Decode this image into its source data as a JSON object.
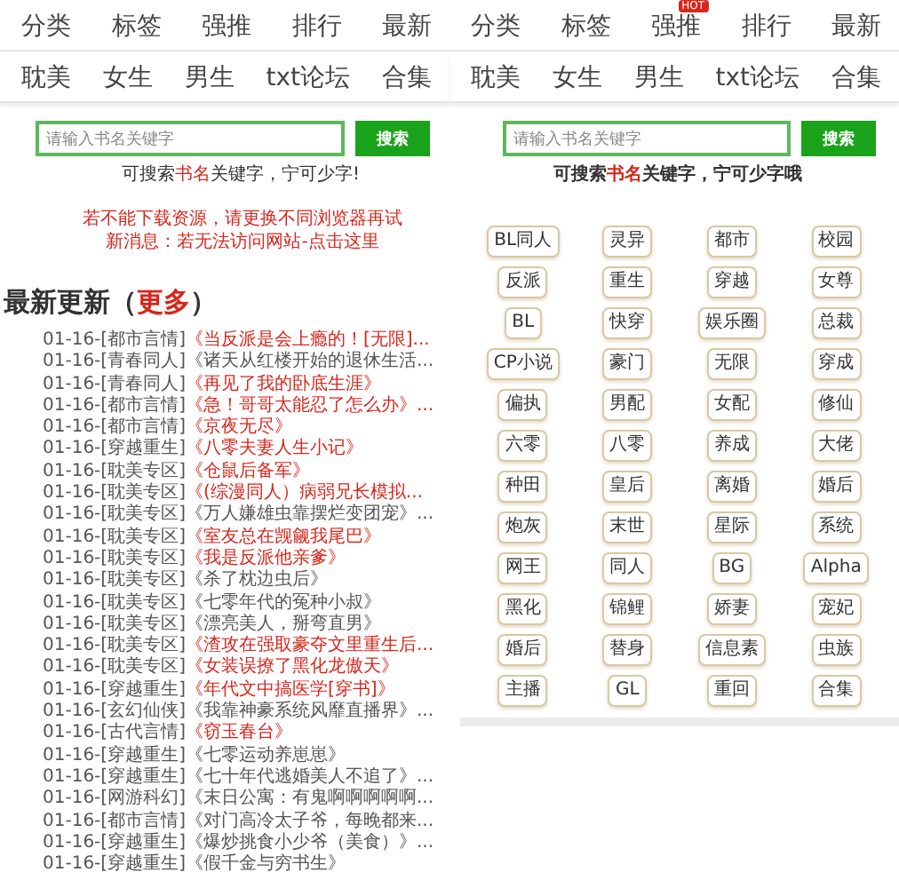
{
  "left_panel": {
    "nav_rows": [
      [
        {
          "label": "分类"
        },
        {
          "label": "标签"
        },
        {
          "label": "强推"
        },
        {
          "label": "排行"
        },
        {
          "label": "最新"
        }
      ],
      [
        {
          "label": "耽美"
        },
        {
          "label": "女生"
        },
        {
          "label": "男生"
        },
        {
          "label": "txt论坛"
        },
        {
          "label": "合集"
        }
      ]
    ],
    "search": {
      "placeholder": "请输入书名关键字",
      "button": "搜索"
    },
    "hint": {
      "before": "可搜索",
      "highlight": "书名",
      "after": "关键字，宁可少字!"
    },
    "notices": [
      "若不能下载资源，请更换不同浏览器再试",
      "新消息：若无法访问网站-点击这里"
    ],
    "latest": {
      "title": "最新更新（",
      "more": "更多",
      "close": "）"
    },
    "updates": [
      {
        "date": "01-16-",
        "category": "[都市言情]",
        "title": "《当反派是会上瘾的！[无限]...",
        "highlight": true
      },
      {
        "date": "01-16-",
        "category": "[青春同人]",
        "title": "《诸天从红楼开始的退休生活...",
        "highlight": false
      },
      {
        "date": "01-16-",
        "category": "[青春同人]",
        "title": "《再见了我的卧底生涯》",
        "highlight": true
      },
      {
        "date": "01-16-",
        "category": "[都市言情]",
        "title": "《急！哥哥太能忍了怎么办》...",
        "highlight": true
      },
      {
        "date": "01-16-",
        "category": "[都市言情]",
        "title": "《京夜无尽》",
        "highlight": true
      },
      {
        "date": "01-16-",
        "category": "[穿越重生]",
        "title": "《八零夫妻人生小记》",
        "highlight": true
      },
      {
        "date": "01-16-",
        "category": "[耽美专区]",
        "title": "《仓鼠后备军》",
        "highlight": true
      },
      {
        "date": "01-16-",
        "category": "[耽美专区]",
        "title": "《(综漫同人）病弱兄长模拟...",
        "highlight": true
      },
      {
        "date": "01-16-",
        "category": "[耽美专区]",
        "title": "《万人嫌雄虫靠摆烂变团宠》...",
        "highlight": false
      },
      {
        "date": "01-16-",
        "category": "[耽美专区]",
        "title": "《室友总在觊觎我尾巴》",
        "highlight": true
      },
      {
        "date": "01-16-",
        "category": "[耽美专区]",
        "title": "《我是反派他亲爹》",
        "highlight": true
      },
      {
        "date": "01-16-",
        "category": "[耽美专区]",
        "title": "《杀了枕边虫后》",
        "highlight": false
      },
      {
        "date": "01-16-",
        "category": "[耽美专区]",
        "title": "《七零年代的冤种小叔》",
        "highlight": false
      },
      {
        "date": "01-16-",
        "category": "[耽美专区]",
        "title": "《漂亮美人，掰弯直男》",
        "highlight": false
      },
      {
        "date": "01-16-",
        "category": "[耽美专区]",
        "title": "《渣攻在强取豪夺文里重生后...",
        "highlight": true
      },
      {
        "date": "01-16-",
        "category": "[耽美专区]",
        "title": "《女装误撩了黑化龙傲天》",
        "highlight": true
      },
      {
        "date": "01-16-",
        "category": "[穿越重生]",
        "title": "《年代文中搞医学[穿书]》",
        "highlight": true
      },
      {
        "date": "01-16-",
        "category": "[玄幻仙侠]",
        "title": "《我靠神豪系统风靡直播界》...",
        "highlight": false
      },
      {
        "date": "01-16-",
        "category": "[古代言情]",
        "title": "《窃玉春台》",
        "highlight": true
      },
      {
        "date": "01-16-",
        "category": "[穿越重生]",
        "title": "《七零运动养崽崽》",
        "highlight": false
      },
      {
        "date": "01-16-",
        "category": "[穿越重生]",
        "title": "《七十年代逃婚美人不追了》...",
        "highlight": false
      },
      {
        "date": "01-16-",
        "category": "[网游科幻]",
        "title": "《末日公寓：有鬼啊啊啊啊啊...",
        "highlight": false
      },
      {
        "date": "01-16-",
        "category": "[都市言情]",
        "title": "《对门高冷太子爷，每晚都来...",
        "highlight": false
      },
      {
        "date": "01-16-",
        "category": "[穿越重生]",
        "title": "《爆炒挑食小少爷（美食）》...",
        "highlight": false
      },
      {
        "date": "01-16-",
        "category": "[穿越重生]",
        "title": "《假千金与穷书生》",
        "highlight": false
      }
    ]
  },
  "right_panel": {
    "nav_rows": [
      [
        {
          "label": "分类"
        },
        {
          "label": "标签"
        },
        {
          "label": "强推",
          "badge": "HOT"
        },
        {
          "label": "排行"
        },
        {
          "label": "最新"
        }
      ],
      [
        {
          "label": "耽美"
        },
        {
          "label": "女生"
        },
        {
          "label": "男生"
        },
        {
          "label": "txt论坛"
        },
        {
          "label": "合集"
        }
      ]
    ],
    "search": {
      "placeholder": "请输入书名关键字",
      "button": "搜索"
    },
    "hint": {
      "before": "可搜索",
      "highlight": "书名",
      "after": "关键字，宁可少字哦"
    },
    "tags": [
      "BL同人",
      "灵异",
      "都市",
      "校园",
      "反派",
      "重生",
      "穿越",
      "女尊",
      "BL",
      "快穿",
      "娱乐圈",
      "总裁",
      "CP小说",
      "豪门",
      "无限",
      "穿成",
      "偏执",
      "男配",
      "女配",
      "修仙",
      "六零",
      "八零",
      "养成",
      "大佬",
      "种田",
      "皇后",
      "离婚",
      "婚后",
      "炮灰",
      "末世",
      "星际",
      "系统",
      "网王",
      "同人",
      "BG",
      "Alpha",
      "黑化",
      "锦鲤",
      "娇妻",
      "宠妃",
      "婚后",
      "替身",
      "信息素",
      "虫族",
      "主播",
      "GL",
      "重回",
      "合集"
    ]
  }
}
